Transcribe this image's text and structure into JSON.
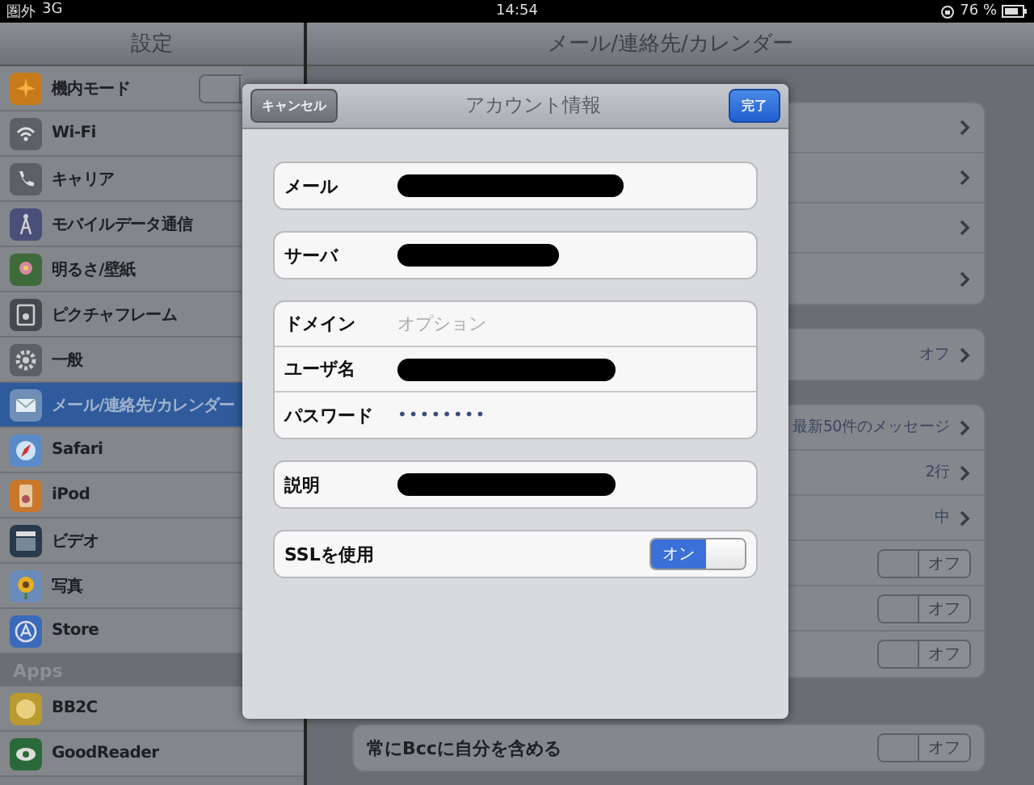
{
  "status_bar": {
    "carrier": "圏外",
    "network": "3G",
    "time": "14:54",
    "battery": "76 %"
  },
  "sidebar": {
    "title": "設定",
    "sections": [
      {
        "items": [
          {
            "label": "機内モード",
            "kind": "toggle",
            "on": false,
            "selected": false
          },
          {
            "label": "Wi-Fi",
            "kind": "plain",
            "selected": false
          },
          {
            "label": "キャリア",
            "kind": "plain",
            "selected": false
          },
          {
            "label": "モバイルデータ通信",
            "kind": "plain",
            "selected": false
          },
          {
            "label": "明るさ/壁紙",
            "kind": "plain",
            "selected": false
          },
          {
            "label": "ピクチャフレーム",
            "kind": "plain",
            "selected": false
          },
          {
            "label": "一般",
            "kind": "plain",
            "selected": false
          },
          {
            "label": "メール/連絡先/カレンダー",
            "kind": "plain",
            "selected": true
          },
          {
            "label": "Safari",
            "kind": "plain",
            "selected": false
          },
          {
            "label": "iPod",
            "kind": "plain",
            "selected": false
          },
          {
            "label": "ビデオ",
            "kind": "plain",
            "selected": false
          },
          {
            "label": "写真",
            "kind": "plain",
            "selected": false
          },
          {
            "label": "Store",
            "kind": "plain",
            "selected": false
          }
        ]
      },
      {
        "header": "Apps",
        "items": [
          {
            "label": "BB2C",
            "kind": "plain",
            "selected": false
          },
          {
            "label": "GoodReader",
            "kind": "plain",
            "selected": false
          }
        ]
      }
    ]
  },
  "detail": {
    "title": "メール/連絡先/カレンダー",
    "groups": [
      {
        "rows": [
          {
            "kind": "chevron"
          },
          {
            "kind": "chevron"
          },
          {
            "kind": "chevron"
          },
          {
            "kind": "chevron"
          }
        ]
      },
      {
        "rows": [
          {
            "kind": "chevron",
            "value": "オフ"
          }
        ]
      },
      {
        "rows": [
          {
            "kind": "chevron",
            "value": "最新50件のメッセージ"
          },
          {
            "kind": "chevron",
            "value": "2行"
          },
          {
            "kind": "chevron",
            "value": "中"
          },
          {
            "kind": "toggle",
            "on": false,
            "value": "オフ"
          },
          {
            "kind": "toggle",
            "on": false,
            "value": "オフ"
          },
          {
            "kind": "toggle",
            "on": false,
            "value": "オフ"
          }
        ]
      },
      {
        "rows": [
          {
            "kind": "toggle",
            "label": "常にBccに自分を含める",
            "on": false,
            "value": "オフ"
          }
        ]
      }
    ]
  },
  "dialog": {
    "title": "アカウント情報",
    "cancel": "キャンセル",
    "done": "完了",
    "groups": [
      {
        "fields": [
          {
            "label": "メール",
            "kind": "redacted"
          }
        ]
      },
      {
        "fields": [
          {
            "label": "サーバ",
            "kind": "redacted"
          }
        ]
      },
      {
        "fields": [
          {
            "label": "ドメイン",
            "kind": "text",
            "placeholder": "オプション"
          },
          {
            "label": "ユーザ名",
            "kind": "redacted"
          },
          {
            "label": "パスワード",
            "kind": "password",
            "value": "••••••••"
          }
        ]
      },
      {
        "fields": [
          {
            "label": "説明",
            "kind": "redacted"
          }
        ]
      },
      {
        "fields": [
          {
            "label": "SSLを使用",
            "kind": "switch",
            "on": true,
            "value": "オン"
          }
        ]
      }
    ]
  }
}
